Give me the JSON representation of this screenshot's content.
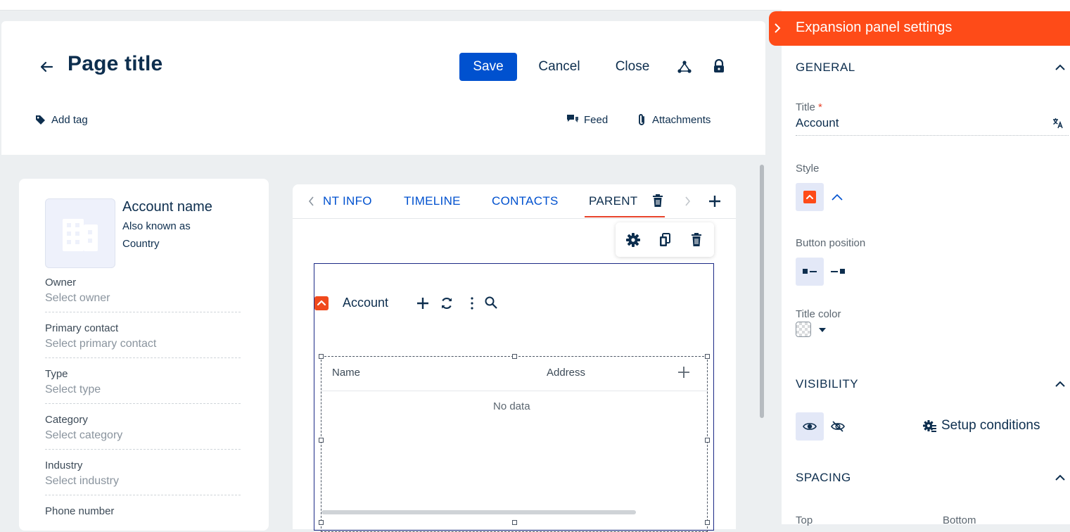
{
  "header": {
    "title": "Page title",
    "save_label": "Save",
    "cancel_label": "Cancel",
    "close_label": "Close",
    "add_tag_label": "Add tag",
    "feed_label": "Feed",
    "attachments_label": "Attachments"
  },
  "record": {
    "name": "Account name",
    "aka": "Also known as",
    "country": "Country",
    "fields": [
      {
        "label": "Owner",
        "placeholder": "Select owner"
      },
      {
        "label": "Primary contact",
        "placeholder": "Select primary contact"
      },
      {
        "label": "Type",
        "placeholder": "Select type"
      },
      {
        "label": "Category",
        "placeholder": "Select category"
      },
      {
        "label": "Industry",
        "placeholder": "Select industry"
      }
    ],
    "phone_label": "Phone number"
  },
  "tabs": [
    {
      "label": "NT INFO"
    },
    {
      "label": "TIMELINE"
    },
    {
      "label": "CONTACTS"
    },
    {
      "label": "PARENT",
      "active": true
    }
  ],
  "expansion_panel": {
    "title": "Account",
    "columns": [
      "Name",
      "Address"
    ],
    "empty_text": "No data"
  },
  "settings": {
    "header": "Expansion panel settings",
    "general": {
      "section": "GENERAL",
      "title_label": "Title",
      "title_required_mark": "*",
      "title_value": "Account",
      "style_label": "Style",
      "button_position_label": "Button position",
      "title_color_label": "Title color"
    },
    "visibility": {
      "section": "VISIBILITY",
      "setup_conditions_label": "Setup conditions"
    },
    "spacing": {
      "section": "SPACING",
      "top_label": "Top",
      "bottom_label": "Bottom"
    }
  },
  "colors": {
    "accent_orange": "#fe4b18",
    "primary_blue": "#0051cf",
    "text_dark": "#0d2e4e",
    "selection_frame": "#1c2a86"
  },
  "icons": [
    "back-arrow-icon",
    "hierarchy-icon",
    "lock-icon",
    "tag-icon",
    "feed-icon",
    "paperclip-icon",
    "building-icon",
    "chevron-left-icon",
    "trash-icon",
    "chevron-right-icon",
    "plus-icon",
    "gear-icon",
    "copy-icon",
    "collapse-icon",
    "refresh-icon",
    "more-vertical-icon",
    "search-icon",
    "translate-icon",
    "chevron-up-icon",
    "eye-icon",
    "eye-off-icon",
    "conditions-gear-icon",
    "caret-down-icon"
  ]
}
